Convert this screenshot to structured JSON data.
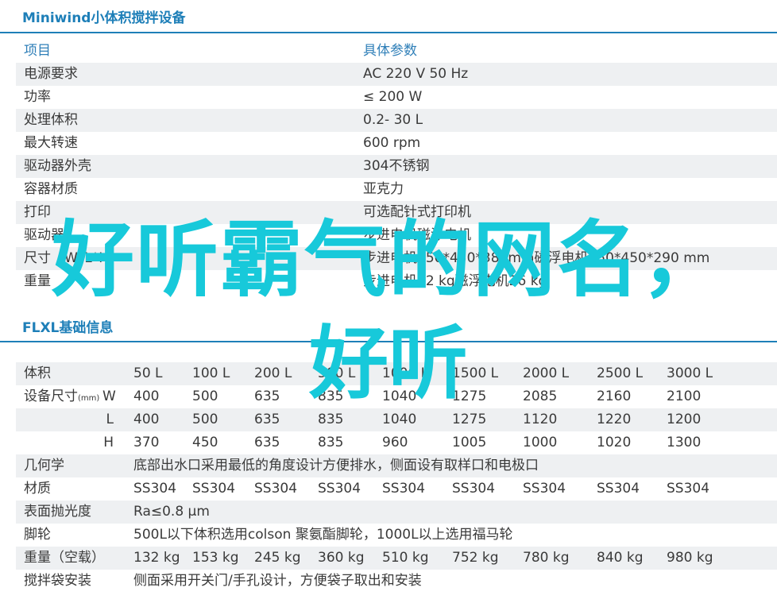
{
  "section1": {
    "title": "Miniwind小体积搅拌设备",
    "header": [
      "项目",
      "具体参数"
    ],
    "rows": [
      [
        "电源要求",
        "AC 220  V 50 Hz"
      ],
      [
        "功率",
        "≤ 200 W"
      ],
      [
        "处理体积",
        "0.2- 30 L"
      ],
      [
        "最大转速",
        "600  rpm"
      ],
      [
        "驱动器外壳",
        "304不锈钢"
      ],
      [
        "容器材质",
        "亚克力"
      ],
      [
        "打印",
        "可选配针式打印机"
      ],
      [
        "驱动器",
        "步进电机磁浮电机"
      ],
      [
        "尺寸（W*L*H）",
        "步进电机450*450*380mm磁浮电机550*450*290 mm"
      ],
      [
        "重量",
        "步进电机22 kg磁浮电机26 kg"
      ]
    ]
  },
  "section2": {
    "title": "FLXL基础信息",
    "volume_row": [
      "体积",
      "50 L",
      "100 L",
      "200 L",
      "500 L",
      "1000 L",
      "1500 L",
      "2000 L",
      "2500 L",
      "3000 L"
    ],
    "size_label": "设备尺寸",
    "size_unit": "(mm)",
    "size_rows": [
      [
        "W",
        "400",
        "500",
        "635",
        "835",
        "1040",
        "1275",
        "2085",
        "2160",
        "2100"
      ],
      [
        "L",
        "400",
        "500",
        "635",
        "835",
        "1040",
        "1275",
        "1120",
        "1220",
        "1200"
      ],
      [
        "H",
        "370",
        "450",
        "635",
        "835",
        "960",
        "1005",
        "1000",
        "1020",
        "1300"
      ]
    ],
    "geometry": [
      "几何学",
      "底部出水口采用最低的角度设计方便排水，侧面设有取样口和电极口"
    ],
    "material_row": [
      "材质",
      "SS304",
      "SS304",
      "SS304",
      "SS304",
      "SS304",
      "SS304",
      "SS304",
      "SS304",
      "SS304"
    ],
    "polish": [
      "表面抛光度",
      "Ra≤0.8 μm"
    ],
    "casters": [
      "脚轮",
      "500L以下体积选用colson 聚氨酯脚轮，1000L以上选用福马轮"
    ],
    "weight_row": [
      "重量（空载）",
      "132 kg",
      "153 kg",
      "245 kg",
      "360 kg",
      "510 kg",
      "752 kg",
      "780 kg",
      "840 kg",
      "980 kg"
    ],
    "bag": [
      "搅拌袋安装",
      "侧面采用开关门/手孔设计，方便袋子取出和安装"
    ]
  },
  "overlay": {
    "line1": "好听霸气的网名，",
    "line2": "好听"
  },
  "colors": {
    "accent": "#1e7fb8",
    "row_shade": "#eef0f2",
    "overlay": "#17c9da"
  }
}
